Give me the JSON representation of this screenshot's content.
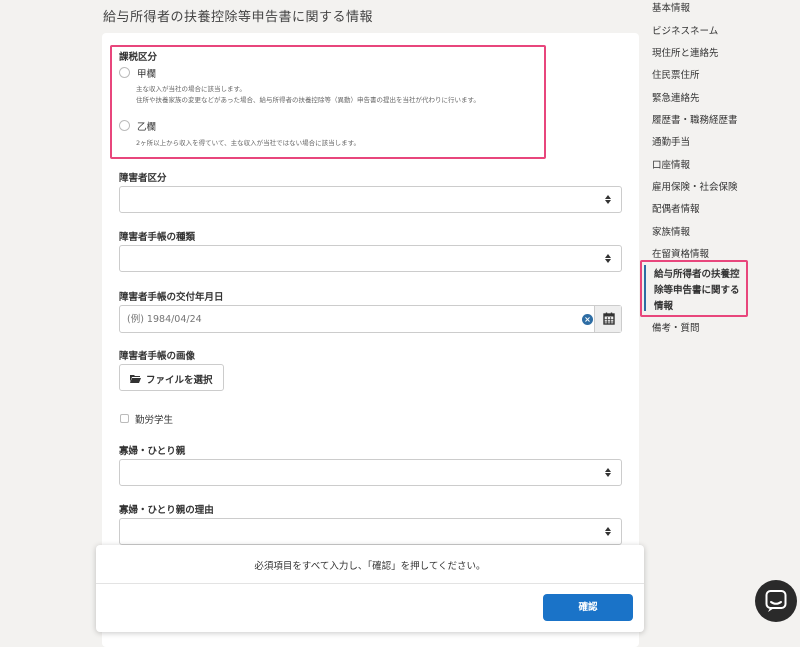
{
  "page": {
    "section_title": "給与所得者の扶養控除等申告書に関する情報"
  },
  "form": {
    "tax_category": {
      "label": "課税区分",
      "options": [
        {
          "label": "甲欄",
          "desc_1": "主な収入が当社の場合に該当します。",
          "desc_2": "住所や扶養家族の変更などがあった場合、給与所得者の扶養控除等（異動）申告書の提出を当社が代わりに行います。"
        },
        {
          "label": "乙欄",
          "desc_1": "2ヶ所以上から収入を得ていて、主な収入が当社ではない場合に該当します。"
        }
      ]
    },
    "disability_category": {
      "label": "障害者区分",
      "value": ""
    },
    "disability_book_type": {
      "label": "障害者手帳の種類",
      "value": ""
    },
    "disability_book_date": {
      "label": "障害者手帳の交付年月日",
      "placeholder": "(例) 1984/04/24"
    },
    "disability_book_image": {
      "label": "障害者手帳の画像",
      "button_label": "ファイルを選択"
    },
    "working_student": {
      "label": "勤労学生",
      "checked": false
    },
    "widow_single_parent": {
      "label": "寡婦・ひとり親",
      "value": ""
    },
    "widow_single_parent_reason": {
      "label": "寡婦・ひとり親の理由",
      "value": ""
    }
  },
  "sidebar": {
    "items": [
      {
        "label": "基本情報"
      },
      {
        "label": "ビジネスネーム"
      },
      {
        "label": "現住所と連絡先"
      },
      {
        "label": "住民票住所"
      },
      {
        "label": "緊急連絡先"
      },
      {
        "label": "履歴書・職務経歴書"
      },
      {
        "label": "通勤手当"
      },
      {
        "label": "口座情報"
      },
      {
        "label": "雇用保険・社会保険"
      },
      {
        "label": "配偶者情報"
      },
      {
        "label": "家族情報"
      },
      {
        "label": "在留資格情報"
      },
      {
        "label": "給与所得者の扶養控除等申告書に関する情報",
        "active": true
      },
      {
        "label": "備考・質問"
      }
    ]
  },
  "footer": {
    "message": "必須項目をすべて入力し、「確認」を押してください。",
    "confirm_label": "確認"
  },
  "colors": {
    "highlight": "#e8467c",
    "primary": "#1a73c8",
    "active_bar": "#2e6da4"
  },
  "icons": {
    "caret": "select-caret-icon",
    "clear": "clear-icon",
    "calendar": "calendar-icon",
    "folder": "folder-icon",
    "chat": "chat-icon"
  }
}
